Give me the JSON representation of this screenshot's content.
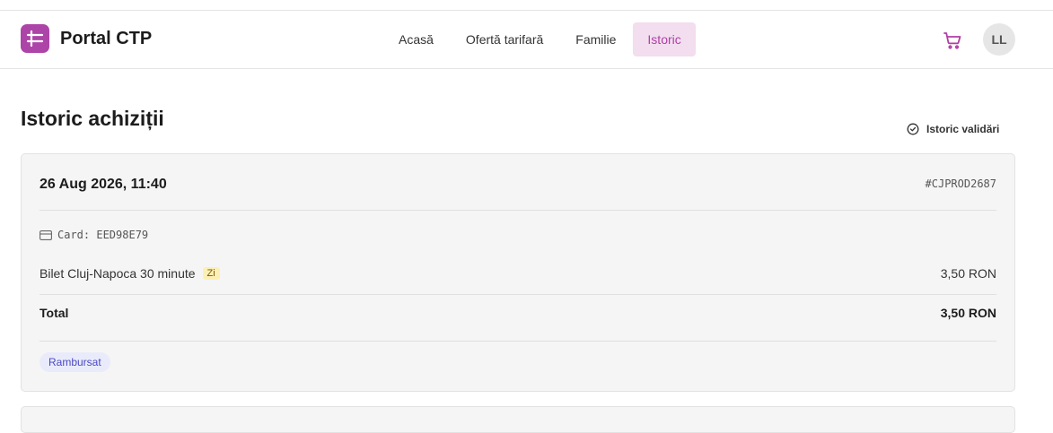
{
  "app": {
    "title": "Portal CTP"
  },
  "nav": {
    "items": [
      {
        "label": "Acasă",
        "active": false
      },
      {
        "label": "Ofertă tarifară",
        "active": false
      },
      {
        "label": "Familie",
        "active": false
      },
      {
        "label": "Istoric",
        "active": true
      }
    ]
  },
  "user": {
    "initials": "LL"
  },
  "icons": {
    "logo": "ticket-icon",
    "cart": "cart-icon",
    "validations": "check-circle-icon",
    "card": "credit-card-icon"
  },
  "colors": {
    "brand": "#ad44a8",
    "nav_active_bg": "#f2deef",
    "nav_active_text": "#b03ea6",
    "status_bg": "#e9ebfb",
    "status_text": "#4b49c4",
    "badge_bg": "#fcefb5"
  },
  "page": {
    "title": "Istoric achiziții",
    "validations_button": "Istoric validări"
  },
  "purchases": [
    {
      "date": "26 Aug 2026, 11:40",
      "order_id": "#CJPROD2687",
      "card_label": "Card: EED98E79",
      "items": [
        {
          "name": "Bilet Cluj-Napoca 30 minute",
          "badge": "Zi",
          "price": "3,50 RON"
        }
      ],
      "total_label": "Total",
      "total_value": "3,50 RON",
      "status": "Rambursat"
    }
  ]
}
